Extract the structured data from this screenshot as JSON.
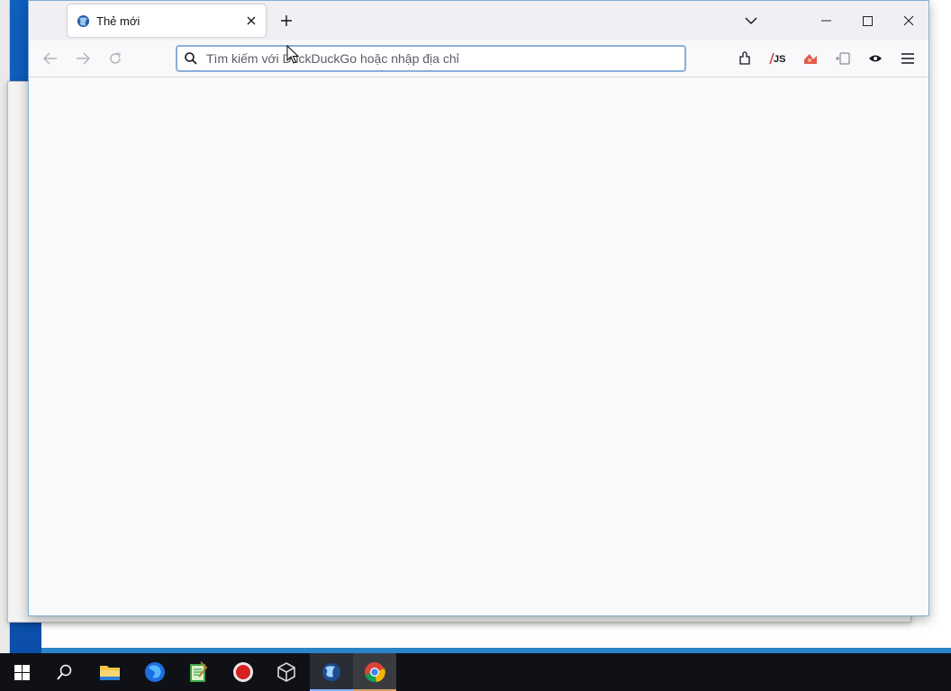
{
  "browser": {
    "tab": {
      "title": "Thẻ mới",
      "favicon": "browser-globe-icon"
    },
    "toolbar": {
      "back_icon": "back-arrow-icon",
      "forward_icon": "forward-arrow-icon",
      "reload_icon": "reload-icon",
      "url_placeholder": "Tìm kiếm với DuckDuckGo hoặc nhập địa chỉ",
      "extensions": [
        "extensions-icon",
        "javascript-toggle-icon",
        "ublock-icon",
        "tab-container-icon",
        "eye-icon",
        "menu-icon"
      ]
    },
    "window_controls": [
      "minimize",
      "maximize",
      "close"
    ]
  },
  "taskbar": {
    "items": [
      "windows-start",
      "search",
      "file-explorer",
      "firefox",
      "notepad",
      "record",
      "virtualbox",
      "waterfox",
      "chrome"
    ]
  },
  "colors": {
    "accent": "#0060df",
    "taskbar": "#0f1117",
    "desktop": "#1565c0"
  }
}
